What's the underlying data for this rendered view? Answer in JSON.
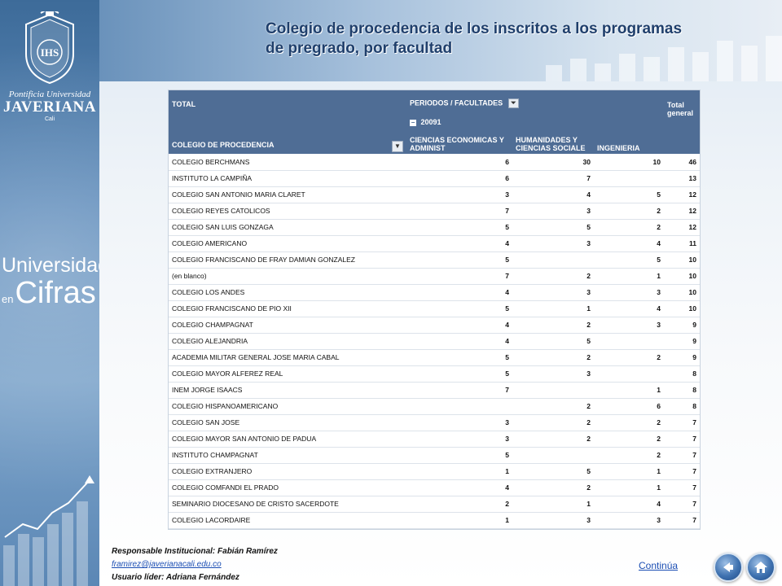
{
  "header": {
    "title_line1": "Colegio  de procedencia de  los  inscritos a los programas",
    "title_line2": "de pregrado,  por facultad"
  },
  "sidebar": {
    "uni_line1": "Pontificia Universidad",
    "uni_line2": "JAVERIANA",
    "uni_city": "Cali",
    "crest_letters": "IHS",
    "cifras_line1": "Universidad",
    "cifras_en": "en",
    "cifras_word": "Cifras"
  },
  "table": {
    "corner_label": "TOTAL",
    "row_field": "COLEGIO DE PROCEDENCIA",
    "column_field": "PERIODOS / FACULTADES",
    "period": "20091",
    "total_header": "Total general",
    "faculties": [
      "CIENCIAS ECONOMICAS Y ADMINIST",
      "HUMANIDADES Y CIENCIAS SOCIALE",
      "INGENIERIA"
    ],
    "rows": [
      {
        "name": "COLEGIO BERCHMANS",
        "c1": "6",
        "c2": "30",
        "c3": "10",
        "total": "46"
      },
      {
        "name": "INSTITUTO LA CAMPIÑA",
        "c1": "6",
        "c2": "7",
        "c3": "",
        "total": "13"
      },
      {
        "name": "COLEGIO SAN ANTONIO MARIA CLARET",
        "c1": "3",
        "c2": "4",
        "c3": "5",
        "total": "12"
      },
      {
        "name": "COLEGIO REYES CATOLICOS",
        "c1": "7",
        "c2": "3",
        "c3": "2",
        "total": "12"
      },
      {
        "name": "COLEGIO SAN LUIS GONZAGA",
        "c1": "5",
        "c2": "5",
        "c3": "2",
        "total": "12"
      },
      {
        "name": "COLEGIO AMERICANO",
        "c1": "4",
        "c2": "3",
        "c3": "4",
        "total": "11"
      },
      {
        "name": "COLEGIO FRANCISCANO DE FRAY DAMIAN GONZALEZ",
        "c1": "5",
        "c2": "",
        "c3": "5",
        "total": "10"
      },
      {
        "name": "(en blanco)",
        "c1": "7",
        "c2": "2",
        "c3": "1",
        "total": "10"
      },
      {
        "name": "COLEGIO LOS ANDES",
        "c1": "4",
        "c2": "3",
        "c3": "3",
        "total": "10"
      },
      {
        "name": "COLEGIO FRANCISCANO DE PIO XII",
        "c1": "5",
        "c2": "1",
        "c3": "4",
        "total": "10"
      },
      {
        "name": "COLEGIO CHAMPAGNAT",
        "c1": "4",
        "c2": "2",
        "c3": "3",
        "total": "9"
      },
      {
        "name": "COLEGIO ALEJANDRIA",
        "c1": "4",
        "c2": "5",
        "c3": "",
        "total": "9"
      },
      {
        "name": "ACADEMIA MILITAR GENERAL JOSE MARIA CABAL",
        "c1": "5",
        "c2": "2",
        "c3": "2",
        "total": "9"
      },
      {
        "name": "COLEGIO MAYOR ALFEREZ REAL",
        "c1": "5",
        "c2": "3",
        "c3": "",
        "total": "8"
      },
      {
        "name": "INEM JORGE ISAACS",
        "c1": "7",
        "c2": "",
        "c3": "1",
        "total": "8"
      },
      {
        "name": "COLEGIO HISPANOAMERICANO",
        "c1": "",
        "c2": "2",
        "c3": "6",
        "total": "8"
      },
      {
        "name": "COLEGIO SAN JOSE",
        "c1": "3",
        "c2": "2",
        "c3": "2",
        "total": "7"
      },
      {
        "name": "COLEGIO MAYOR SAN ANTONIO DE PADUA",
        "c1": "3",
        "c2": "2",
        "c3": "2",
        "total": "7"
      },
      {
        "name": "INSTITUTO CHAMPAGNAT",
        "c1": "5",
        "c2": "",
        "c3": "2",
        "total": "7"
      },
      {
        "name": "COLEGIO EXTRANJERO",
        "c1": "1",
        "c2": "5",
        "c3": "1",
        "total": "7"
      },
      {
        "name": "COLEGIO COMFANDI EL PRADO",
        "c1": "4",
        "c2": "2",
        "c3": "1",
        "total": "7"
      },
      {
        "name": "SEMINARIO DIOCESANO DE CRISTO SACERDOTE",
        "c1": "2",
        "c2": "1",
        "c3": "4",
        "total": "7"
      },
      {
        "name": "COLEGIO LACORDAIRE",
        "c1": "1",
        "c2": "3",
        "c3": "3",
        "total": "7"
      }
    ]
  },
  "footer": {
    "responsable": "Responsable  Institucional: Fabián Ramírez",
    "email": "framirez@javerianacali.edu.co",
    "lider": "Usuario líder: Adriana Fernández",
    "continue_link": "Continúa"
  },
  "icons": {
    "back": "back-arrow-icon",
    "home": "home-icon"
  },
  "colors": {
    "table_header": "#4f6d95",
    "title_text": "#1f3f6c",
    "link": "#1a4db3"
  }
}
